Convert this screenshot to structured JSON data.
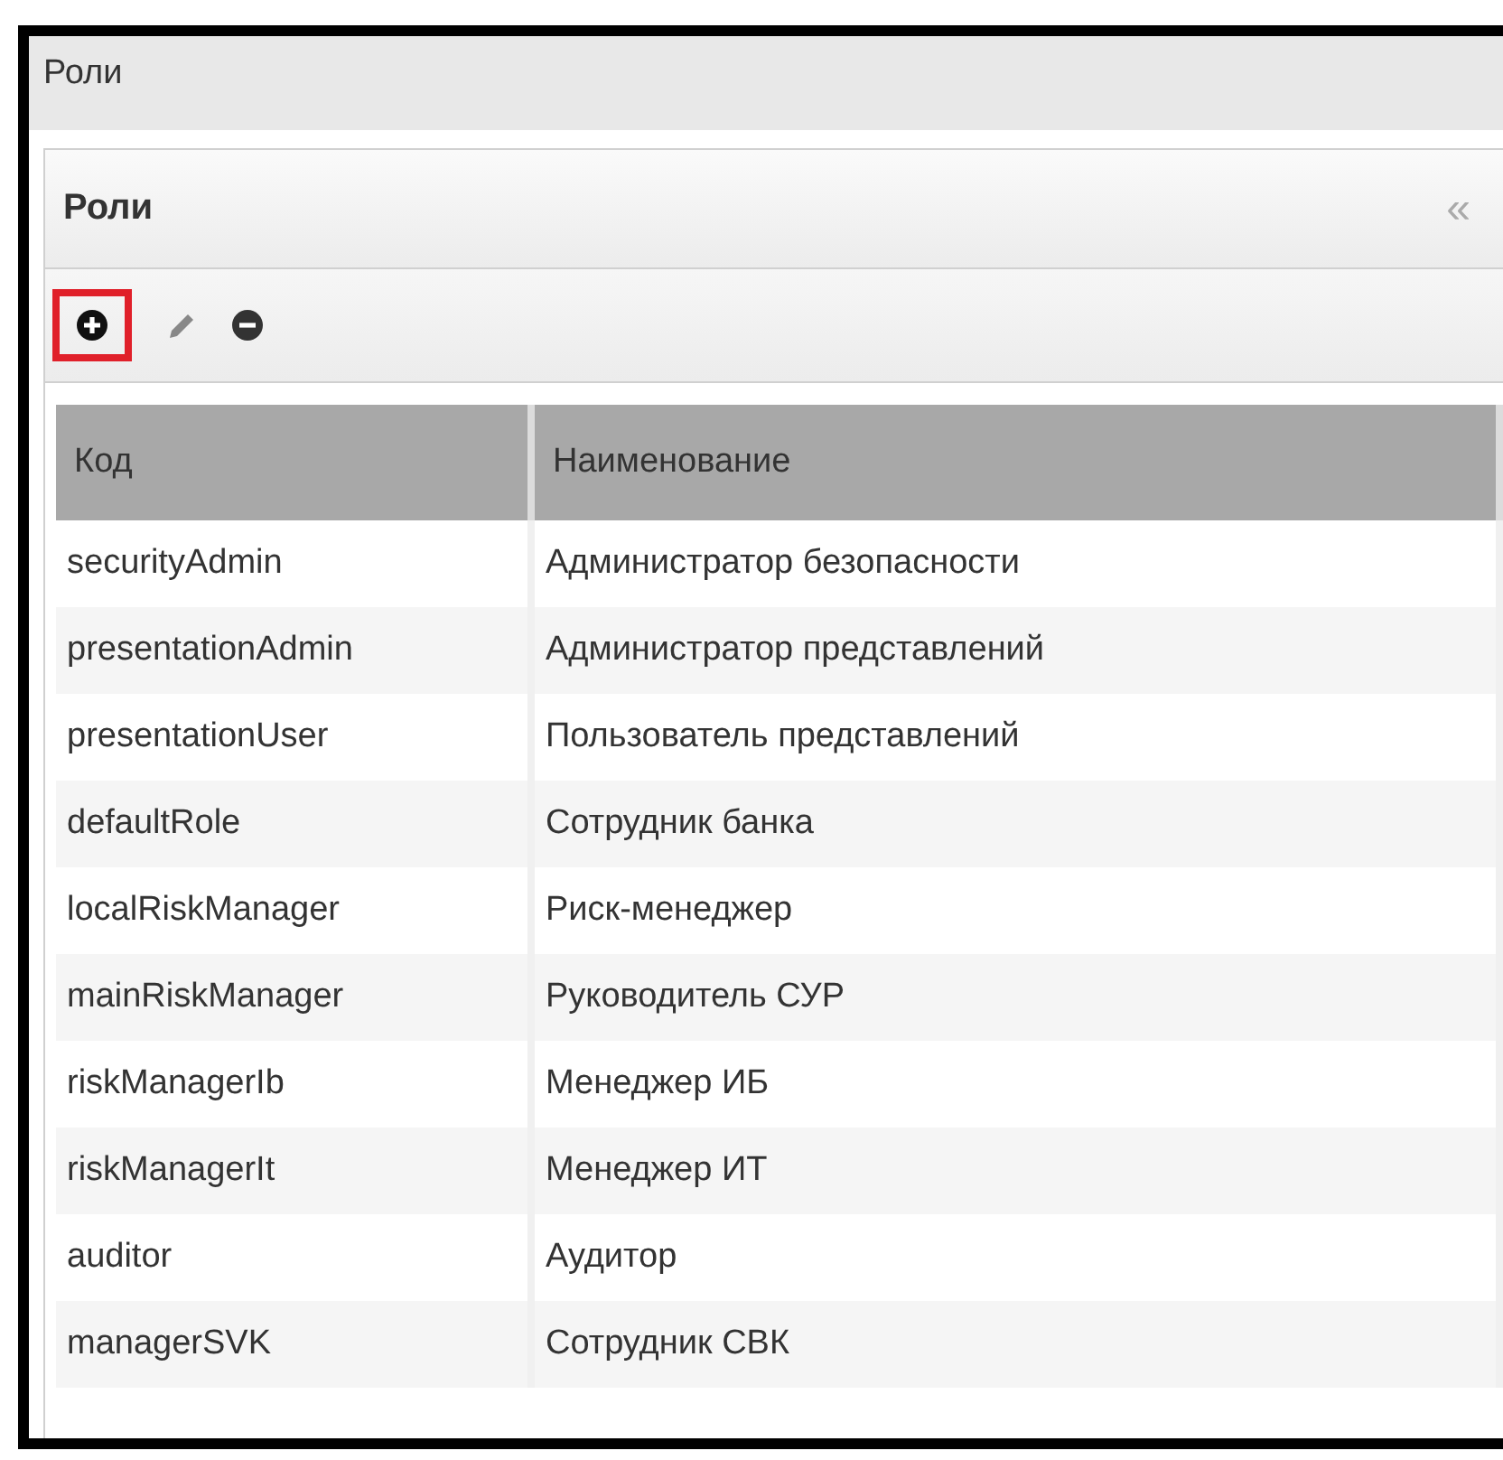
{
  "window": {
    "title": "Роли"
  },
  "panel": {
    "title": "Роли",
    "collapse_glyph": "«"
  },
  "toolbar": [
    {
      "kind": "add",
      "highlighted": true
    },
    {
      "kind": "edit",
      "highlighted": false
    },
    {
      "kind": "remove",
      "highlighted": false
    }
  ],
  "table": {
    "columns": [
      "Код",
      "Наименование"
    ],
    "rows": [
      [
        "securityAdmin",
        "Администратор безопасности"
      ],
      [
        "presentationAdmin",
        "Администратор представлений"
      ],
      [
        "presentationUser",
        "Пользователь представлений"
      ],
      [
        "defaultRole",
        "Сотрудник банка"
      ],
      [
        "localRiskManager",
        "Риск-менеджер"
      ],
      [
        "mainRiskManager",
        "Руководитель СУР"
      ],
      [
        "riskManagerIb",
        "Менеджер ИБ"
      ],
      [
        "riskManagerIt",
        "Менеджер ИТ"
      ],
      [
        "auditor",
        "Аудитор"
      ],
      [
        "managerSVK",
        "Сотрудник СВК"
      ]
    ]
  }
}
